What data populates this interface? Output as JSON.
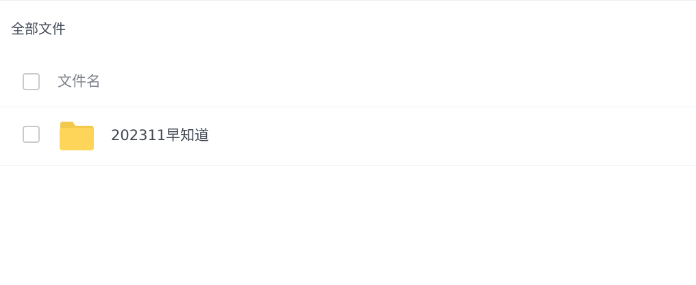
{
  "breadcrumb": {
    "label": "全部文件"
  },
  "table": {
    "columns": [
      {
        "label": "文件名"
      }
    ],
    "rows": [
      {
        "name": "202311早知道",
        "icon": "folder-icon"
      }
    ]
  },
  "colors": {
    "folder": "#ffd559",
    "text": "#404652",
    "muted_text": "#7d828b",
    "divider": "#eef0f2",
    "checkbox_border": "#c7cacf"
  }
}
